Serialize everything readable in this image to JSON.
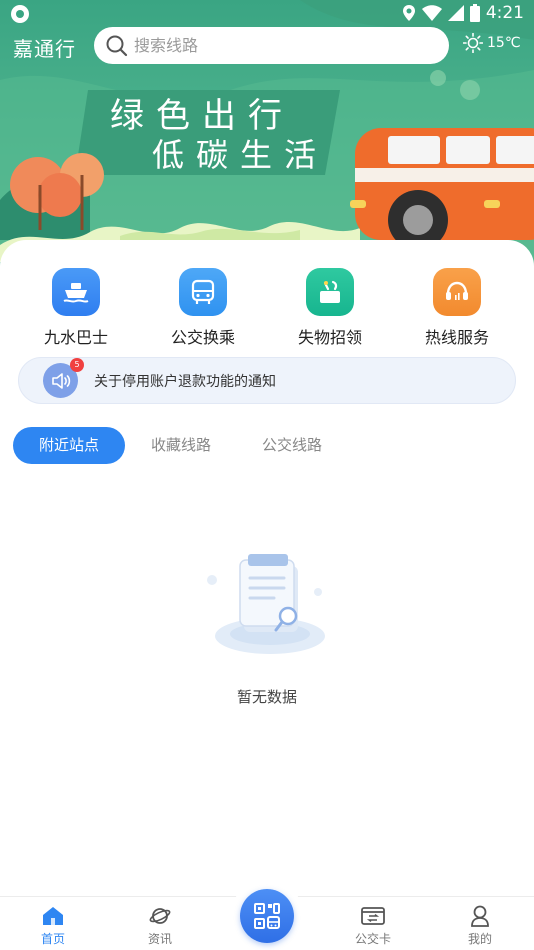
{
  "status_bar": {
    "time": "4:21"
  },
  "header": {
    "app_title": "嘉通行",
    "search_placeholder": "搜索线路",
    "weather_temp": "15℃"
  },
  "banner": {
    "line1": "绿色出行",
    "line2": "低碳生活"
  },
  "quick_actions": [
    {
      "label": "九水巴士",
      "icon": "ship-icon",
      "color": "#2f7ef0"
    },
    {
      "label": "公交换乘",
      "icon": "bus-icon",
      "color": "#2f92f0"
    },
    {
      "label": "失物招领",
      "icon": "lost-found-icon",
      "color": "#17b58f"
    },
    {
      "label": "热线服务",
      "icon": "headset-icon",
      "color": "#f28a2e"
    }
  ],
  "notice": {
    "badge": "5",
    "text": "关于停用账户退款功能的通知"
  },
  "tabs": [
    {
      "label": "附近站点",
      "active": true
    },
    {
      "label": "收藏线路",
      "active": false
    },
    {
      "label": "公交线路",
      "active": false
    }
  ],
  "empty_state": {
    "text": "暂无数据"
  },
  "bottom_nav": [
    {
      "label": "首页",
      "icon": "home-icon",
      "active": true
    },
    {
      "label": "资讯",
      "icon": "planet-icon",
      "active": false
    },
    {
      "label": "公交卡",
      "icon": "card-icon",
      "active": false
    },
    {
      "label": "我的",
      "icon": "user-icon",
      "active": false
    }
  ],
  "colors": {
    "accent": "#2e86f2",
    "banner_green": "#4db28d"
  }
}
